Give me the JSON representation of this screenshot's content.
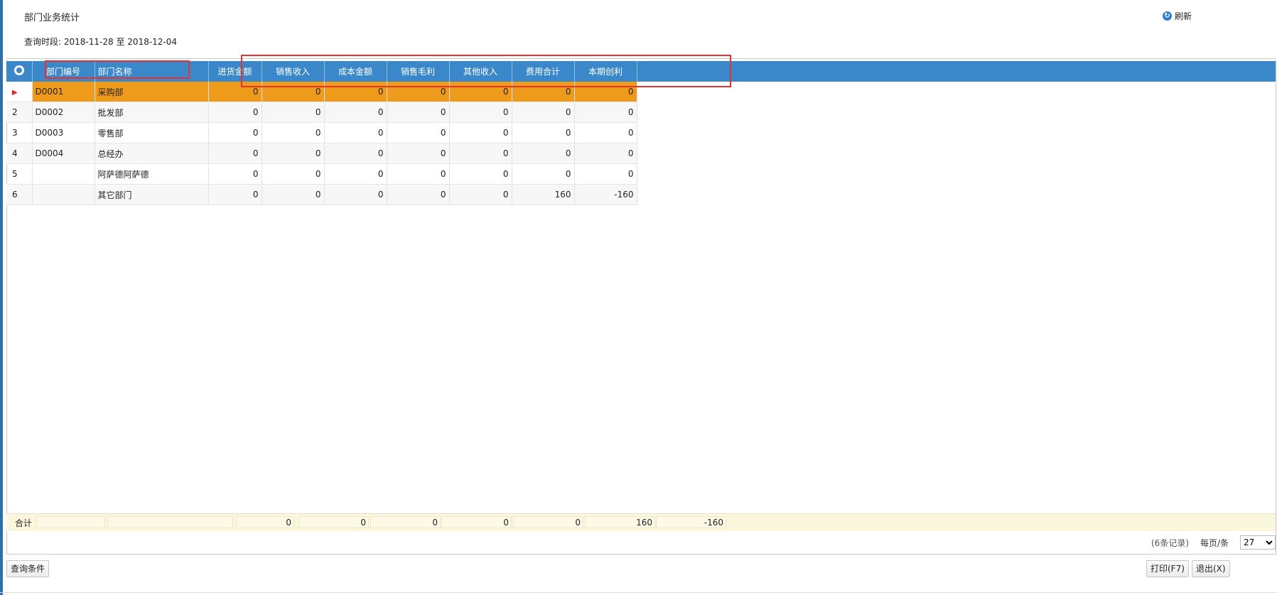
{
  "page": {
    "title": "部门业务统计",
    "period_label": "查询时段:",
    "period_start": "2018-11-28",
    "period_sep": "至",
    "period_end": "2018-12-04",
    "refresh_label": "刷新"
  },
  "grid": {
    "columns": [
      "部门编号",
      "部门名称",
      "进货金额",
      "销售收入",
      "成本金额",
      "销售毛利",
      "其他收入",
      "费用合计",
      "本期创利"
    ],
    "rows": [
      {
        "idx": "",
        "code": "D0001",
        "name": "采购部",
        "values": [
          "0",
          "0",
          "0",
          "0",
          "0",
          "0",
          "0"
        ],
        "selected": true
      },
      {
        "idx": "2",
        "code": "D0002",
        "name": "批发部",
        "values": [
          "0",
          "0",
          "0",
          "0",
          "0",
          "0",
          "0"
        ]
      },
      {
        "idx": "3",
        "code": "D0003",
        "name": "零售部",
        "values": [
          "0",
          "0",
          "0",
          "0",
          "0",
          "0",
          "0"
        ]
      },
      {
        "idx": "4",
        "code": "D0004",
        "name": "总经办",
        "values": [
          "0",
          "0",
          "0",
          "0",
          "0",
          "0",
          "0"
        ]
      },
      {
        "idx": "5",
        "code": "",
        "name": "阿萨德阿萨德",
        "values": [
          "0",
          "0",
          "0",
          "0",
          "0",
          "0",
          "0"
        ]
      },
      {
        "idx": "6",
        "code": "",
        "name": "其它部门",
        "values": [
          "0",
          "0",
          "0",
          "0",
          "0",
          "160",
          "-160"
        ]
      }
    ],
    "totals": {
      "label": "合计",
      "values": [
        "0",
        "0",
        "0",
        "0",
        "0",
        "160",
        "-160"
      ]
    }
  },
  "pager": {
    "records": "(6条记录)",
    "per_page_label": "每页/条",
    "per_page_value": "27"
  },
  "buttons": {
    "query": "查询条件",
    "print": "打印(F7)",
    "exit": "退出(X)"
  },
  "colors": {
    "header": "#3a87c9",
    "selected_row": "#ee9a1a",
    "annotation": "#e8302c"
  }
}
